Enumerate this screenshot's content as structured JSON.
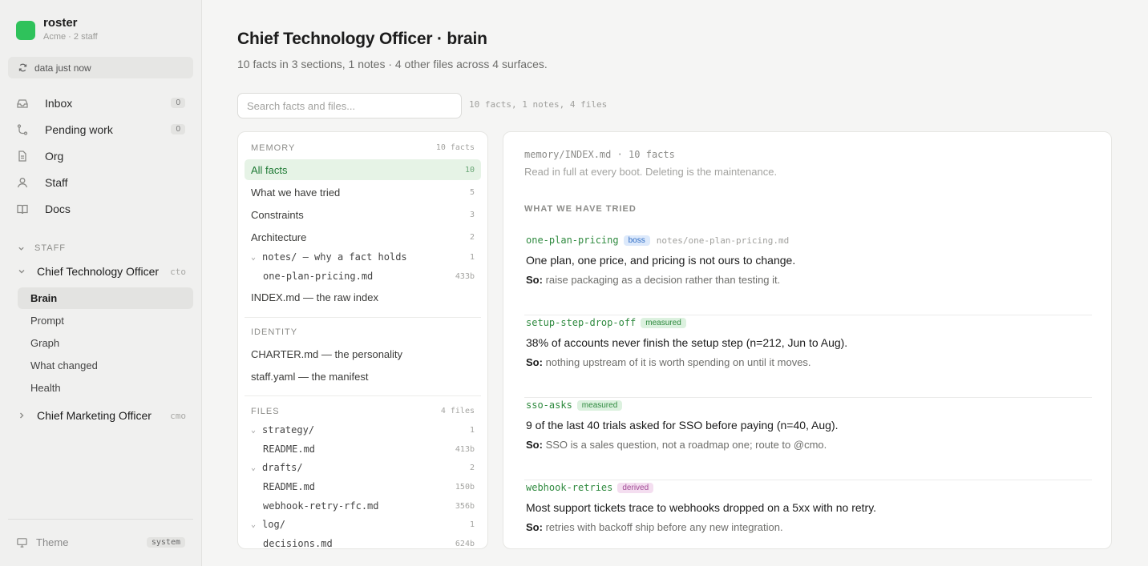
{
  "app": {
    "name": "roster",
    "org": "Acme · 2 staff"
  },
  "sync": {
    "label": "data just now"
  },
  "nav": [
    {
      "label": "Inbox",
      "icon": "inbox-icon",
      "count": "0"
    },
    {
      "label": "Pending work",
      "icon": "branch-icon",
      "count": "0"
    },
    {
      "label": "Org",
      "icon": "document-icon",
      "count": ""
    },
    {
      "label": "Staff",
      "icon": "person-icon",
      "count": ""
    },
    {
      "label": "Docs",
      "icon": "book-icon",
      "count": ""
    }
  ],
  "staff": {
    "heading": "STAFF",
    "agents": [
      {
        "name": "Chief Technology Officer",
        "tag": "cto",
        "expanded": true,
        "subitems": [
          "Brain",
          "Prompt",
          "Graph",
          "What changed",
          "Health"
        ],
        "active": "Brain"
      },
      {
        "name": "Chief Marketing Officer",
        "tag": "cmo",
        "expanded": false
      }
    ]
  },
  "theme": {
    "label": "Theme",
    "value": "system"
  },
  "page": {
    "title": "Chief Technology Officer · brain",
    "subtitle": "10 facts in 3 sections, 1 notes · 4 other files across 4 surfaces."
  },
  "search": {
    "placeholder": "Search facts and files...",
    "meta": "10 facts, 1 notes, 4 files"
  },
  "memory": {
    "heading": "MEMORY",
    "count": "10 facts",
    "items": [
      {
        "label": "All facts",
        "n": "10"
      },
      {
        "label": "What we have tried",
        "n": "5"
      },
      {
        "label": "Constraints",
        "n": "3"
      },
      {
        "label": "Architecture",
        "n": "2"
      }
    ],
    "notes_folder": {
      "label": "notes/ — why a fact holds",
      "n": "1"
    },
    "notes_file": {
      "label": "one-plan-pricing.md",
      "n": "433b"
    },
    "index": {
      "label": "INDEX.md — the raw index"
    }
  },
  "identity": {
    "heading": "IDENTITY",
    "items": [
      "CHARTER.md — the personality",
      "staff.yaml — the manifest"
    ]
  },
  "files": {
    "heading": "FILES",
    "count": "4 files",
    "folders": [
      {
        "name": "strategy/",
        "n": "1",
        "files": [
          {
            "name": "README.md",
            "size": "413b"
          }
        ]
      },
      {
        "name": "drafts/",
        "n": "2",
        "files": [
          {
            "name": "README.md",
            "size": "150b"
          },
          {
            "name": "webhook-retry-rfc.md",
            "size": "356b"
          }
        ]
      },
      {
        "name": "log/",
        "n": "1",
        "files": [
          {
            "name": "decisions.md",
            "size": "624b"
          }
        ]
      }
    ]
  },
  "detail": {
    "path": "memory/INDEX.md · 10 facts",
    "desc": "Read in full at every boot. Deleting is the maintenance.",
    "section": "WHAT WE HAVE TRIED",
    "so_label": "So:",
    "facts": [
      {
        "key": "one-plan-pricing",
        "badge": "boss",
        "file": "notes/one-plan-pricing.md",
        "statement": "One plan, one price, and pricing is not ours to change.",
        "so": "raise packaging as a decision rather than testing it."
      },
      {
        "key": "setup-step-drop-off",
        "badge": "measured",
        "file": "",
        "statement": "38% of accounts never finish the setup step (n=212, Jun to Aug).",
        "so": "nothing upstream of it is worth spending on until it moves."
      },
      {
        "key": "sso-asks",
        "badge": "measured",
        "file": "",
        "statement": "9 of the last 40 trials asked for SSO before paying (n=40, Aug).",
        "so": "SSO is a sales question, not a roadmap one; route to @cmo."
      },
      {
        "key": "webhook-retries",
        "badge": "derived",
        "file": "",
        "statement": "Most support tickets trace to webhooks dropped on a 5xx with no retry.",
        "so": "retries with backoff ship before any new integration."
      }
    ]
  }
}
